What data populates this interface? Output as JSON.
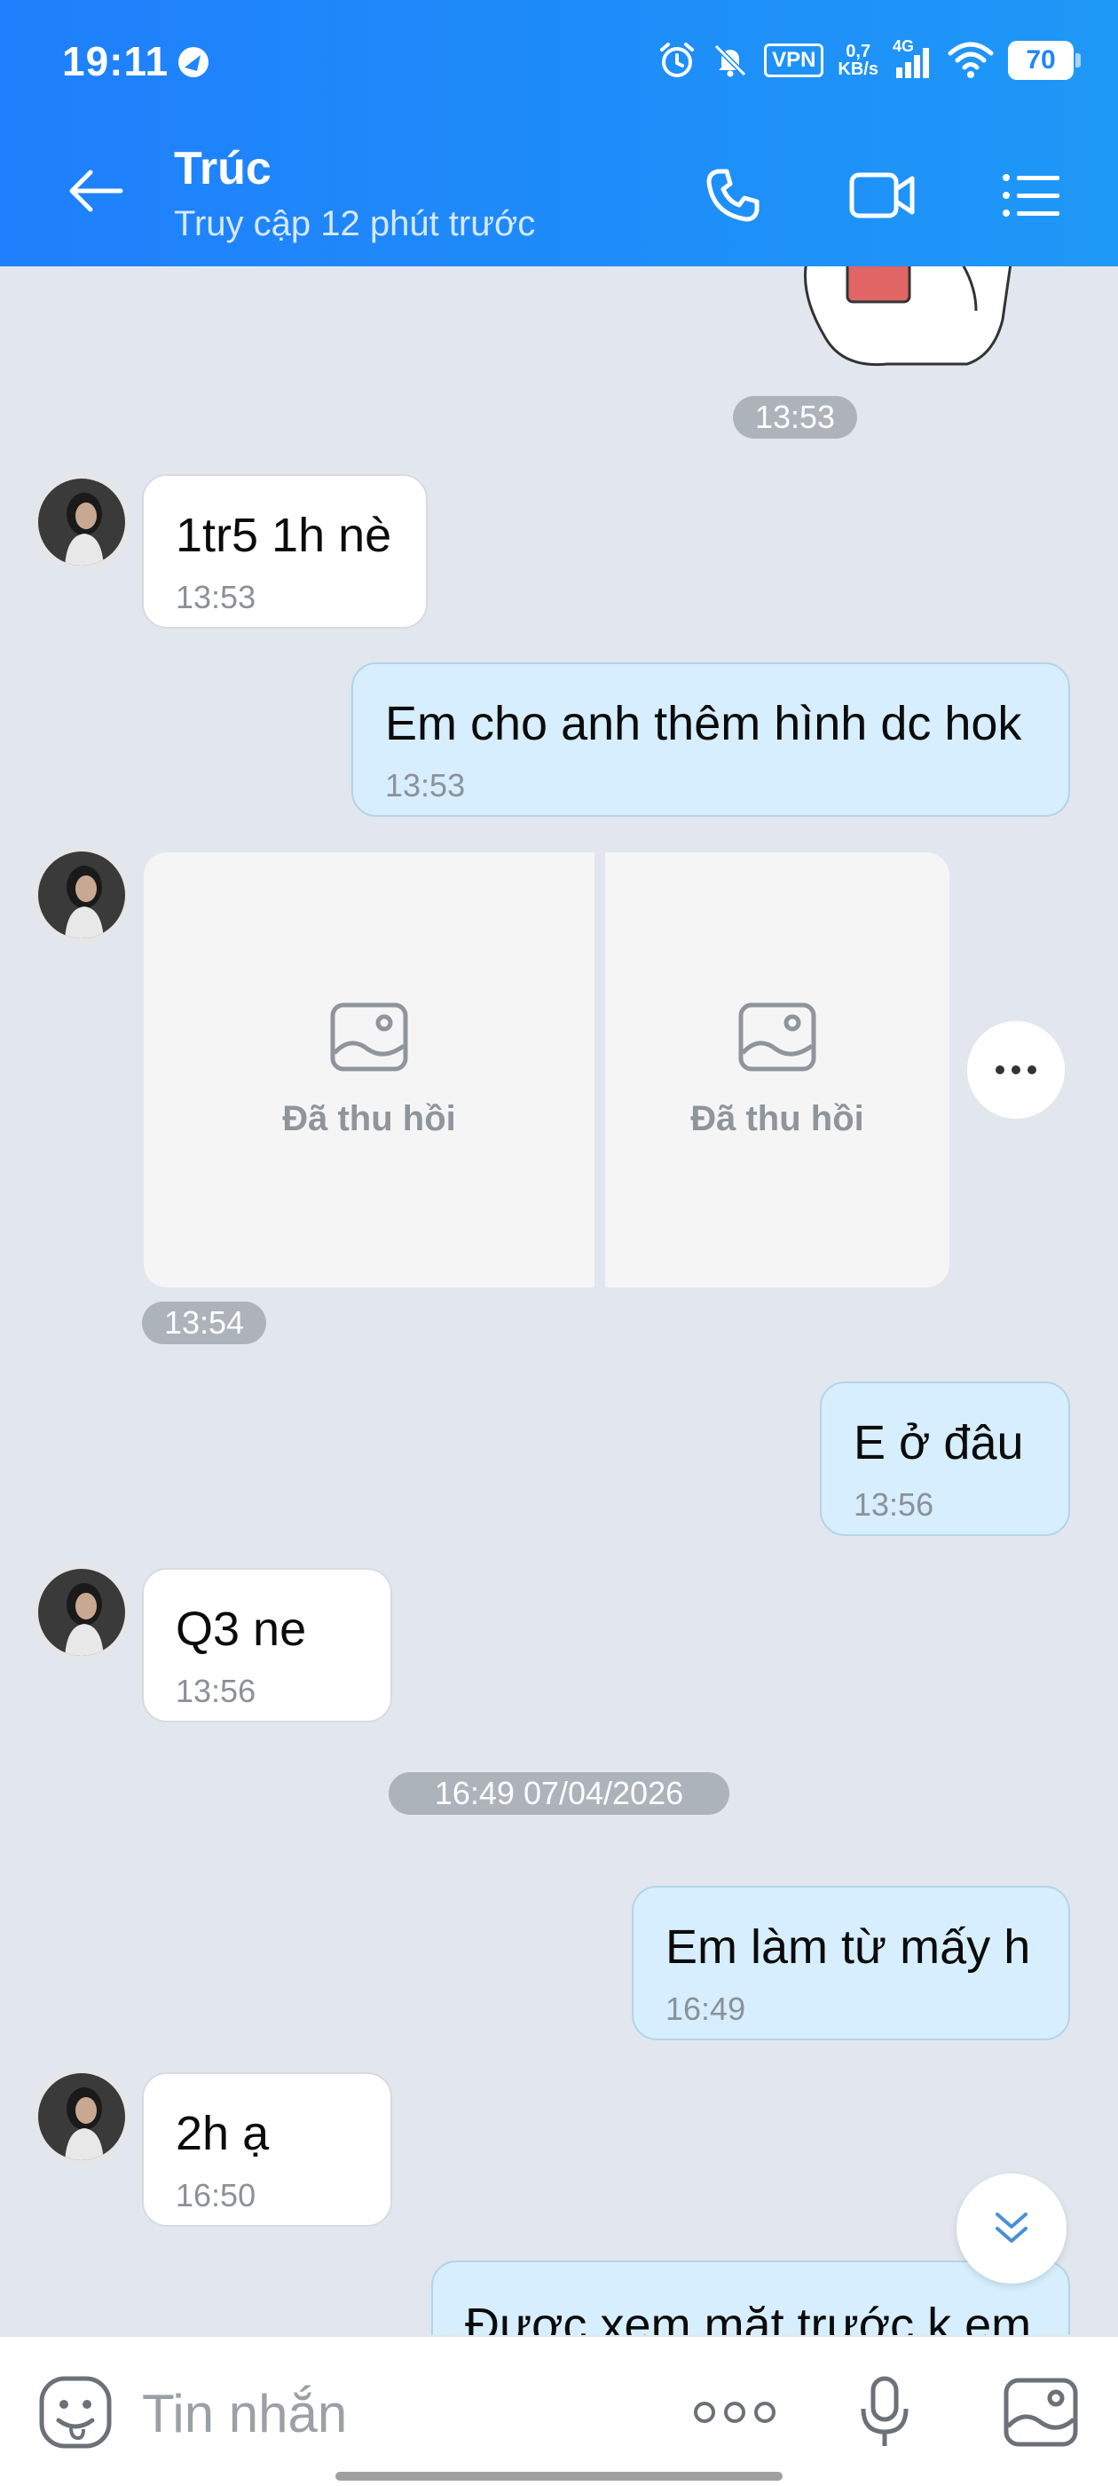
{
  "status_bar": {
    "time": "19:11",
    "vpn": "VPN",
    "speed_value": "0,7",
    "speed_unit": "KB/s",
    "network": "4G",
    "battery": "70"
  },
  "header": {
    "contact_name": "Trúc",
    "contact_status": "Truy cập 12 phút trước",
    "accent_color": "#1f86fb"
  },
  "messages": [
    {
      "side": "time",
      "label": "13:53"
    },
    {
      "side": "in",
      "text": "1tr5 1h nè",
      "time": "13:53"
    },
    {
      "side": "out",
      "text": "Em cho anh thêm hình dc hok",
      "time": "13:53"
    },
    {
      "side": "in-images",
      "items": [
        "Đã thu hồi",
        "Đã thu hồi"
      ],
      "time": "13:54"
    },
    {
      "side": "out",
      "text": "E ở đâu",
      "time": "13:56"
    },
    {
      "side": "in",
      "text": "Q3 ne",
      "time": "13:56"
    },
    {
      "side": "date",
      "label": "16:49 07/04/2026"
    },
    {
      "side": "out",
      "text": "Em làm từ mấy h",
      "time": "16:49"
    },
    {
      "side": "in",
      "text": "2h ạ",
      "time": "16:50"
    },
    {
      "side": "out",
      "text": "Được xem mặt trước k em",
      "time": ""
    }
  ],
  "input": {
    "placeholder": "Tin nhắn"
  },
  "icons": [
    "back-arrow-icon",
    "phone-icon",
    "video-call-icon",
    "menu-list-icon",
    "emoji-icon",
    "more-dots-icon",
    "microphone-icon",
    "image-icon",
    "chevron-double-down-icon",
    "image-placeholder-icon"
  ]
}
